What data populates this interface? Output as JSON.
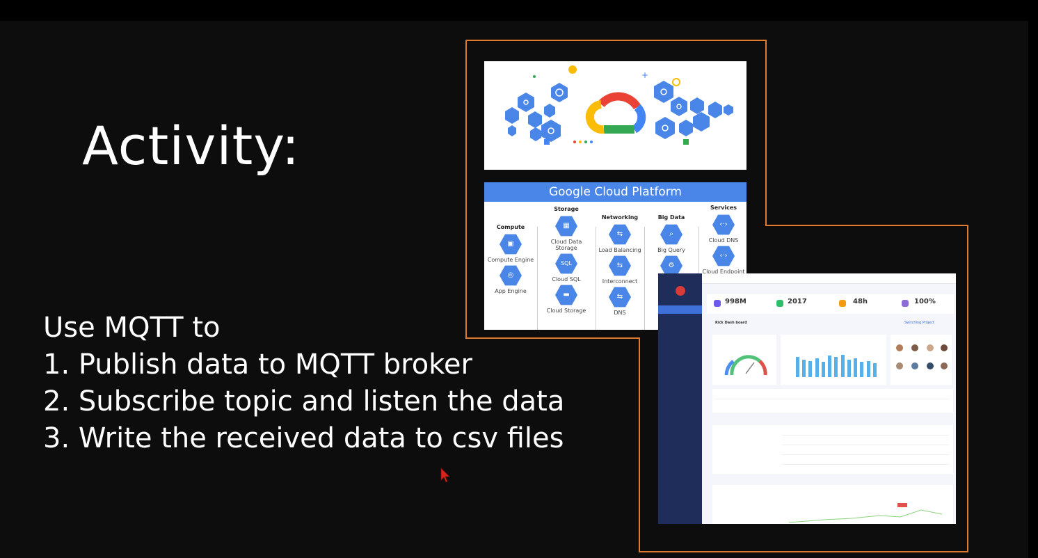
{
  "slide": {
    "title": "Activity:",
    "intro": "Use MQTT to",
    "steps": [
      "1. Publish data to MQTT broker",
      "2. Subscribe topic and listen the data",
      "3. Write the received data to csv files"
    ],
    "accent_color": "#e07a2e"
  },
  "gcp": {
    "header": "Google Cloud Platform",
    "columns": [
      {
        "heading": "Compute",
        "items": [
          "Compute Engine",
          "App Engine"
        ]
      },
      {
        "heading": "Storage",
        "items": [
          "Cloud Data Storage",
          "Cloud SQL",
          "Cloud Storage"
        ]
      },
      {
        "heading": "Networking",
        "items": [
          "Load Balancing",
          "Interconnect",
          "DNS"
        ]
      },
      {
        "heading": "Big Data",
        "items": [
          "Big Query",
          ""
        ]
      },
      {
        "heading": "Services",
        "items": [
          "Cloud DNS",
          "Cloud Endpoint"
        ]
      }
    ],
    "sql_glyph": "SQL"
  },
  "dashboard": {
    "stats": [
      {
        "value": "998M",
        "color": "#6c5ce7"
      },
      {
        "value": "2017",
        "color": "#2bbf6a"
      },
      {
        "value": "48h",
        "color": "#f39c12"
      },
      {
        "value": "100%",
        "color": "#8e6cd8"
      }
    ],
    "board_title": "Rick Dash board",
    "project_link": "Switching Project",
    "chart_bars": [
      0.8,
      0.7,
      0.65,
      0.75,
      0.6,
      0.85,
      0.8,
      0.9,
      0.7,
      0.75,
      0.6,
      0.65,
      0.55
    ],
    "marker": "●"
  },
  "cloud_icons": {
    "logo": "google-cloud-logo"
  }
}
